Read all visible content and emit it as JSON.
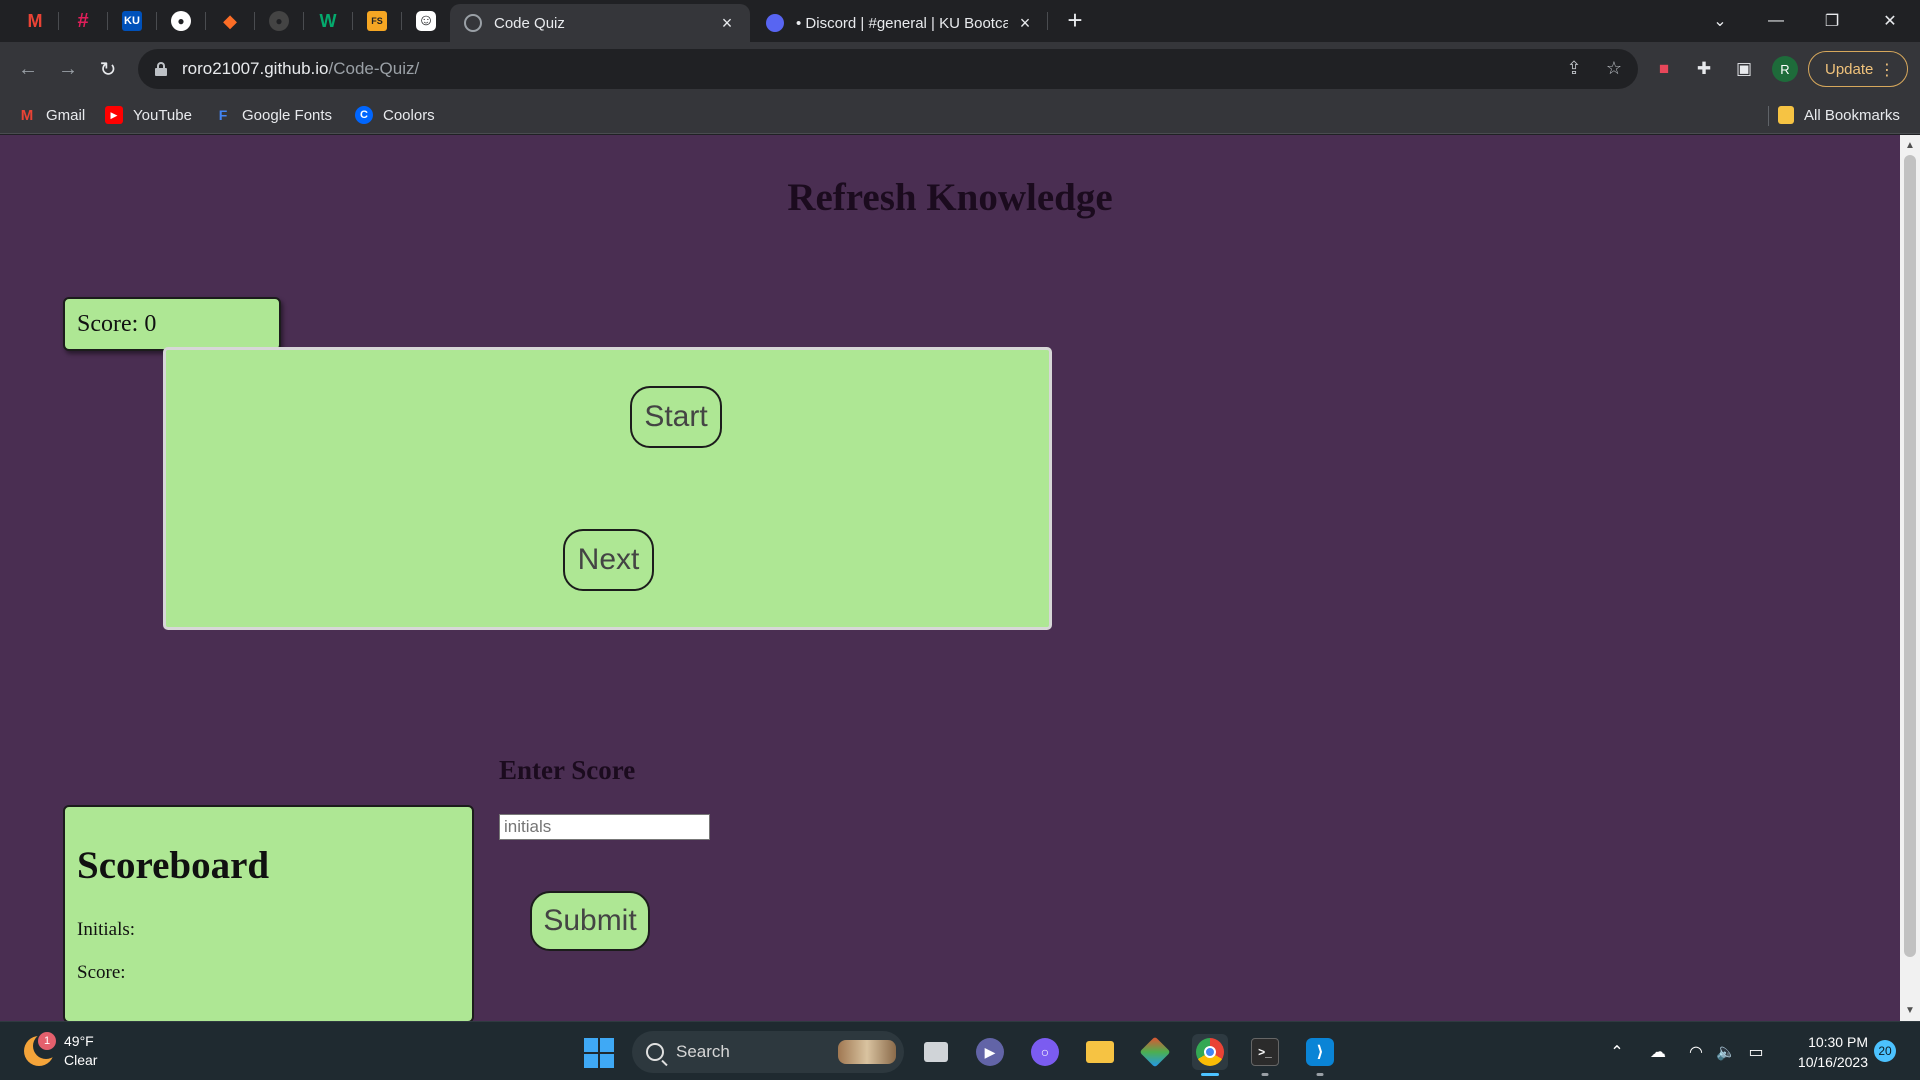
{
  "browser": {
    "tabs": [
      {
        "label": "Code Quiz",
        "active": true
      },
      {
        "label": "• Discord | #general | KU Bootcamp",
        "active": false
      }
    ],
    "pinned_tabs": [
      {
        "name": "gmail",
        "glyph": "M",
        "color": "#ea4335"
      },
      {
        "name": "slack",
        "glyph": "#",
        "color": "#e01e5a"
      },
      {
        "name": "ku",
        "glyph": "KU",
        "color": "#0051ba"
      },
      {
        "name": "github",
        "glyph": "●",
        "color": "#ffffff"
      },
      {
        "name": "gitlab",
        "glyph": "◆",
        "color": "#fc6d26"
      },
      {
        "name": "github-dark",
        "glyph": "●",
        "color": "#555555"
      },
      {
        "name": "w3",
        "glyph": "W",
        "color": "#04aa6d"
      },
      {
        "name": "fs",
        "glyph": "FS",
        "color": "#f5a623"
      },
      {
        "name": "app",
        "glyph": "☺",
        "color": "#ffffff"
      }
    ],
    "address": {
      "host": "roro21007.github.io",
      "path": "/Code-Quiz/"
    },
    "profile_initial": "R",
    "update_label": "Update",
    "bookmarks": [
      {
        "label": "Gmail",
        "color": "#ea4335",
        "glyph": "M"
      },
      {
        "label": "YouTube",
        "color": "#ff0000",
        "glyph": "▶"
      },
      {
        "label": "Google Fonts",
        "color": "#4285f4",
        "glyph": "F"
      },
      {
        "label": "Coolors",
        "color": "#0066ff",
        "glyph": "C"
      }
    ],
    "all_bookmarks_label": "All Bookmarks"
  },
  "page": {
    "title": "Refresh Knowledge",
    "score_label": "Score: 0",
    "start_label": "Start",
    "next_label": "Next",
    "enter_score_heading": "Enter Score",
    "initials_placeholder": "initials",
    "initials_value": "",
    "submit_label": "Submit",
    "scoreboard": {
      "title": "Scoreboard",
      "initials_label": "Initials:",
      "score_label": "Score:"
    },
    "colors": {
      "background": "#4a2e52",
      "panel": "#aee794"
    }
  },
  "taskbar": {
    "weather_temp": "49°F",
    "weather_desc": "Clear",
    "weather_badge": "1",
    "search_label": "Search",
    "time": "10:30 PM",
    "date": "10/16/2023",
    "notification_count": "20"
  }
}
